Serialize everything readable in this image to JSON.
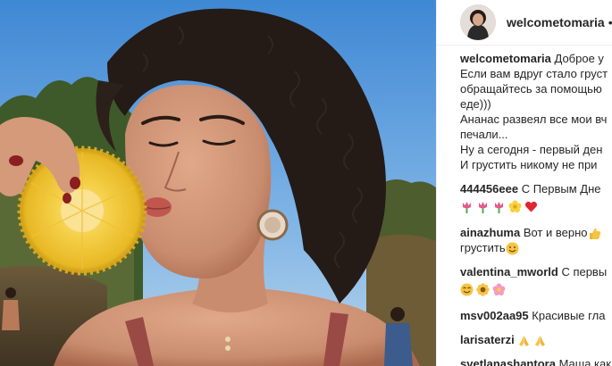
{
  "post": {
    "username": "welcometomaria",
    "header_separator": "•",
    "caption_lines": [
      "Доброе у",
      "Если вам вдруг стало груст",
      "обращайтесь за помощью",
      "еде)))",
      "Ананас развеял все мои вч",
      "печали...",
      "Ну а сегодня - первый ден",
      "И грустить никому не при"
    ]
  },
  "comments": [
    {
      "username": "444456eee",
      "text": "С Первым Дне",
      "emojis": [
        "tulip",
        "tulip",
        "tulip",
        "blossom",
        "red-heart"
      ]
    },
    {
      "username": "ainazhuma",
      "text": "Вот и верно",
      "text2": "грустить",
      "emojis_inline": [
        "thumbs-up"
      ],
      "emojis_end": [
        "smiling-face"
      ]
    },
    {
      "username": "valentina_mworld",
      "text": "С первы",
      "emojis": [
        "smiling-face",
        "sunflower",
        "blossom-pink"
      ]
    },
    {
      "username": "msv002aa95",
      "text": "Красивые гла"
    },
    {
      "username": "larisaterzi",
      "emojis_inline": [
        "folded-hands",
        "folded-hands"
      ]
    },
    {
      "username": "svetlanashantora",
      "text": "Маша,как"
    }
  ],
  "colors": {
    "sky": "#5b96d6",
    "pineapple": "#f2c838",
    "hair": "#241a16",
    "skin": "#c98c6e"
  }
}
